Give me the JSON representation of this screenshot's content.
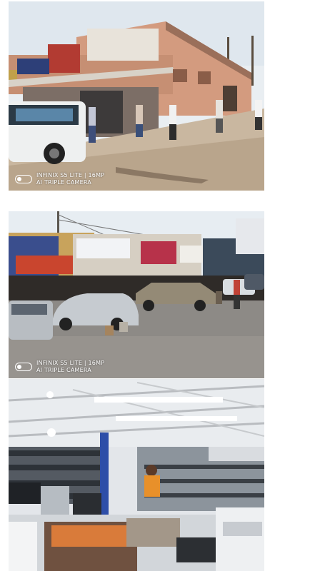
{
  "photos": [
    {
      "id": "storefront-street",
      "watermark": {
        "line1": "INFINIX S5 LITE | 16MP",
        "line2": "AI TRIPLE CAMERA"
      }
    },
    {
      "id": "market-parking",
      "watermark": {
        "line1": "INFINIX S5 LITE | 16MP",
        "line2": "AI TRIPLE CAMERA"
      }
    },
    {
      "id": "shop-interior",
      "watermark": null
    }
  ]
}
